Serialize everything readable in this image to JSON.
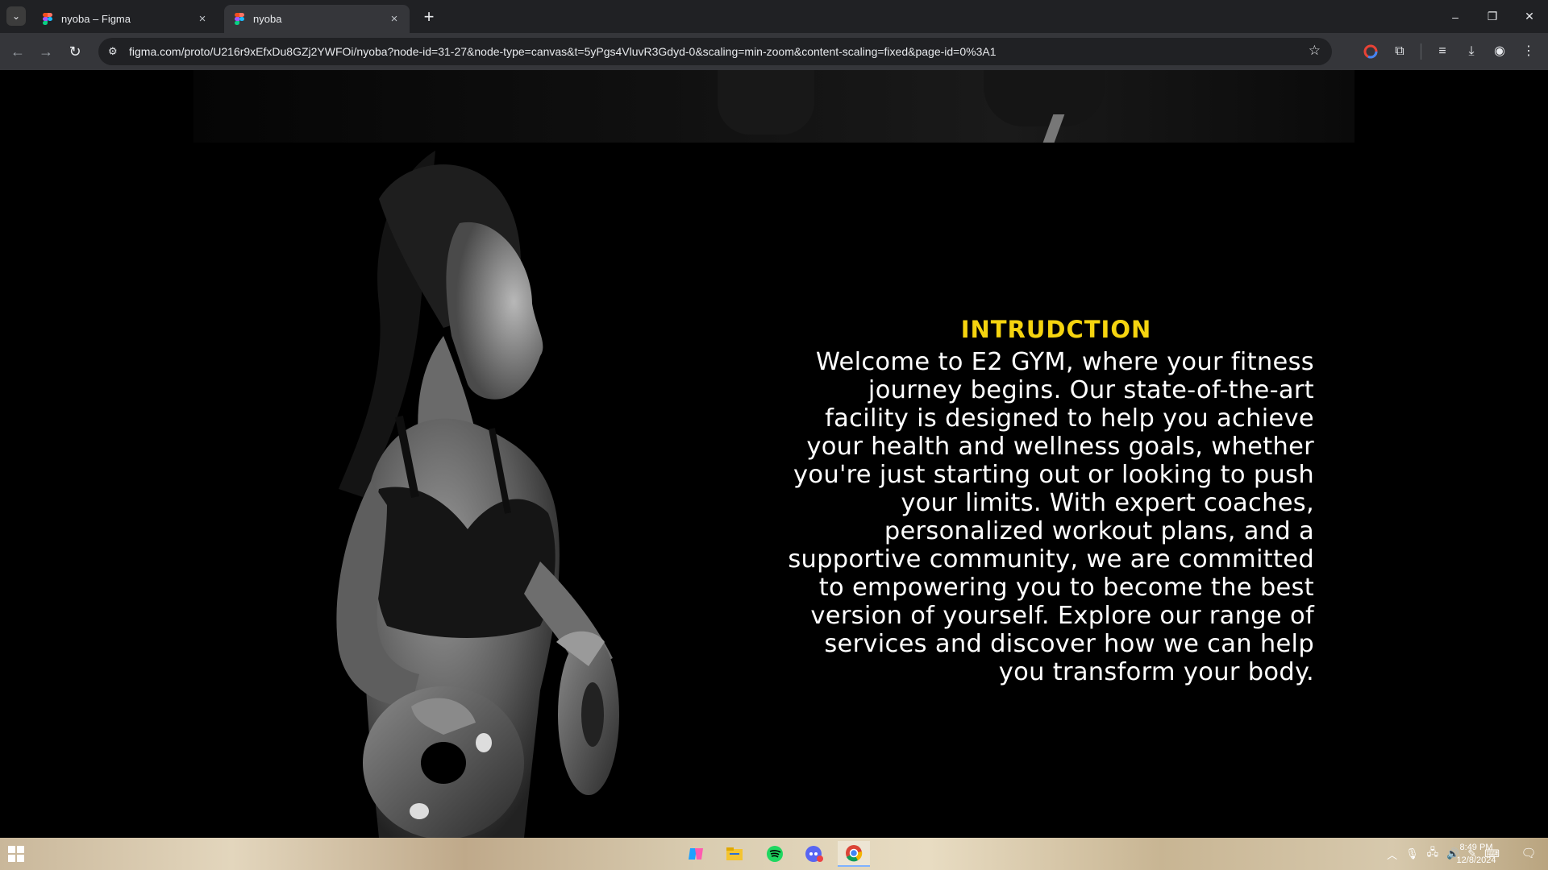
{
  "browser": {
    "tabs": [
      {
        "title": "nyoba – Figma",
        "active": false
      },
      {
        "title": "nyoba",
        "active": true
      }
    ],
    "url": "figma.com/proto/U216r9xEfxDu8GZj2YWFOi/nyoba?node-id=31-27&node-type=canvas&t=5yPgs4VluvR3Gdyd-0&scaling=min-zoom&content-scaling=fixed&page-id=0%3A1",
    "window_controls": {
      "minimize": "–",
      "restore": "❐",
      "close": "✕"
    },
    "nav": {
      "back": "←",
      "forward": "→",
      "reload": "↻"
    },
    "icons": {
      "tab_search": "chevron-down-icon",
      "new_tab": "+",
      "close_tab": "×",
      "bookmark": "☆"
    }
  },
  "page": {
    "heading": "INTRUDCTION",
    "body": "Welcome to E2 GYM, where your fitness journey begins. Our state-of-the-art facility is designed to help you achieve your health and wellness goals, whether you're just starting out or looking to push your limits. With expert coaches, personalized workout plans, and a supportive community, we are committed to empowering you to become the best version of yourself. Explore our range of services and discover how we can help you transform your body.",
    "accent_color": "#f5d40f"
  },
  "taskbar": {
    "clock_time": "8:49 PM",
    "clock_date": "12/8/2024",
    "apps": [
      "copilot-icon",
      "file-explorer-icon",
      "spotify-icon",
      "discord-icon",
      "chrome-icon"
    ]
  }
}
